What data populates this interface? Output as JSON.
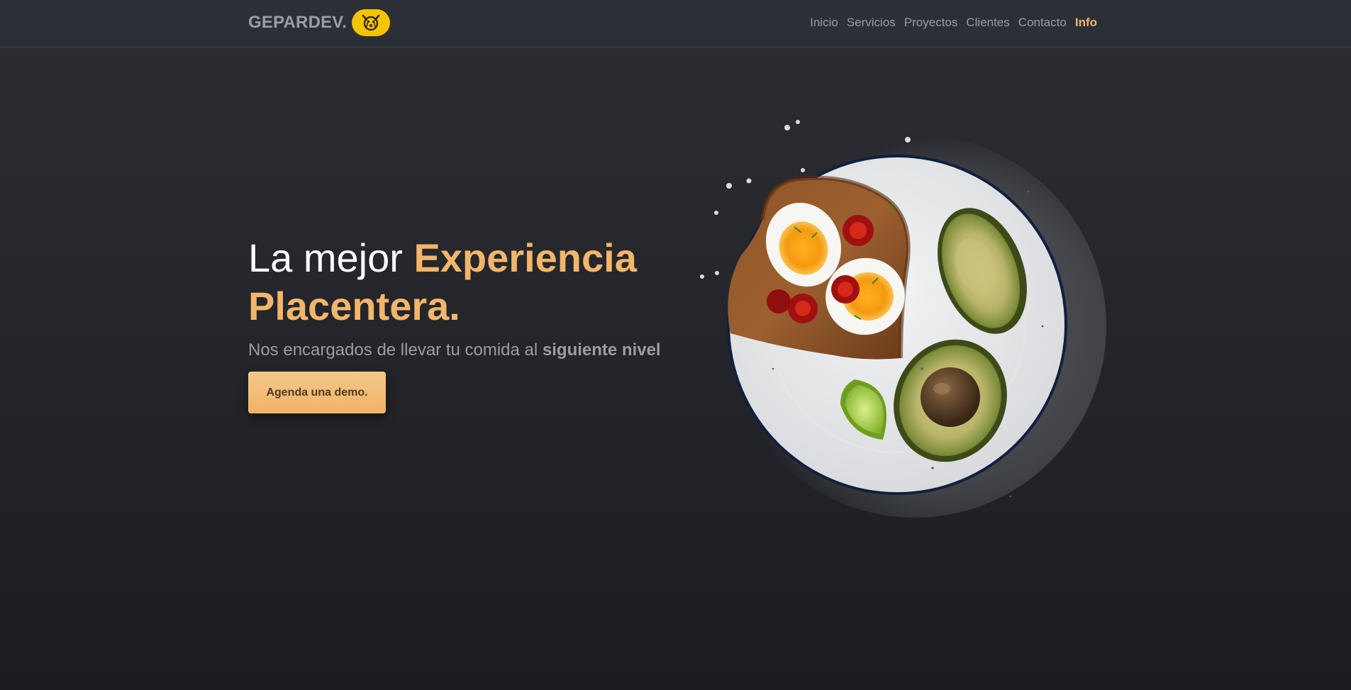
{
  "brand": {
    "name": "GEPARDEV.",
    "logo_icon": "cheetah-face-icon",
    "logo_color": "#f5c400"
  },
  "nav": {
    "items": [
      {
        "label": "Inicio"
      },
      {
        "label": "Servicios"
      },
      {
        "label": "Proyectos"
      },
      {
        "label": "Clientes"
      },
      {
        "label": "Contacto"
      },
      {
        "label": "Info"
      }
    ],
    "active_index": 5
  },
  "hero": {
    "title_plain": "La mejor ",
    "title_highlight_1": "Experiencia",
    "title_highlight_2": "Placentera.",
    "subtitle_plain": "Nos encargados de llevar tu comida al ",
    "subtitle_bold": "siguiente nivel",
    "cta_label": "Agenda una demo."
  },
  "colors": {
    "accent": "#f2b66a",
    "background": "#2c2e34",
    "muted_text": "#9a9da2"
  }
}
